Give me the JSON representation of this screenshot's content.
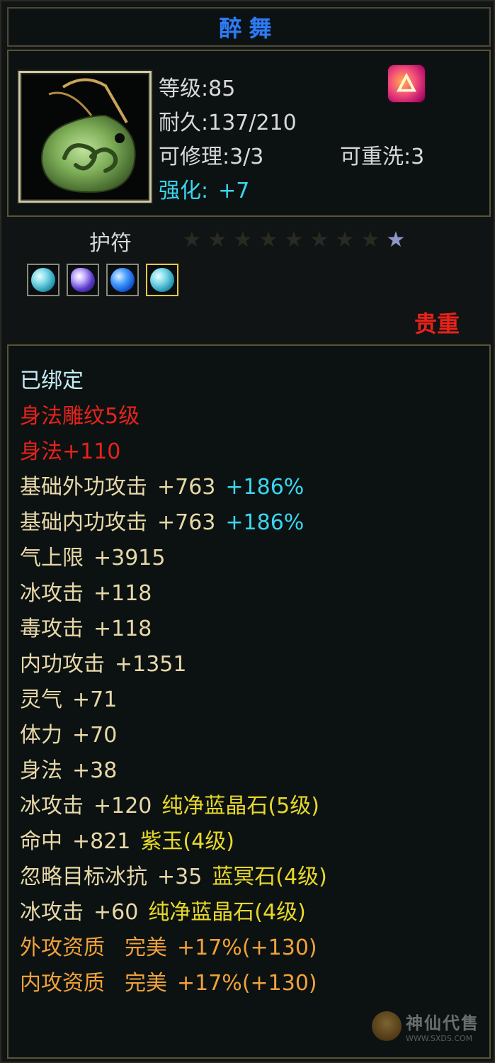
{
  "item": {
    "name": "醉舞",
    "level": "等级:85",
    "durability": "耐久:137/210",
    "repair": "可修理:3/3",
    "rewash": "可重洗:3",
    "enhance_label": "强化:",
    "enhance_value": "+7"
  },
  "type": "护符",
  "stars": {
    "total": 9,
    "lit": 1
  },
  "gems": [
    {
      "kind": "aqua",
      "slot": "normal"
    },
    {
      "kind": "purple",
      "slot": "normal"
    },
    {
      "kind": "blue",
      "slot": "normal"
    },
    {
      "kind": "aqua",
      "slot": "gold"
    }
  ],
  "rarity": "贵重",
  "attrs": {
    "bound": "已绑定",
    "carve": "身法雕纹5级",
    "carve_bonus": "身法+110",
    "ext_atk": {
      "label": "基础外功攻击",
      "value": "+763",
      "pct": "+186%"
    },
    "int_atk": {
      "label": "基础内功攻击",
      "value": "+763",
      "pct": "+186%"
    },
    "lines": [
      {
        "label": "气上限",
        "value": "+3915"
      },
      {
        "label": "冰攻击",
        "value": "+118"
      },
      {
        "label": "毒攻击",
        "value": "+118"
      },
      {
        "label": "内功攻击",
        "value": "+1351"
      },
      {
        "label": "灵气",
        "value": "+71"
      },
      {
        "label": "体力",
        "value": "+70"
      },
      {
        "label": "身法",
        "value": "+38"
      }
    ],
    "gem_lines": [
      {
        "label": "冰攻击",
        "value": "+120",
        "gem": "纯净蓝晶石(5级)"
      },
      {
        "label": "命中",
        "value": "+821",
        "gem": "紫玉(4级)"
      },
      {
        "label": "忽略目标冰抗",
        "value": "+35",
        "gem": "蓝冥石(4级)"
      },
      {
        "label": "冰攻击",
        "value": "+60",
        "gem": "纯净蓝晶石(4级)"
      }
    ],
    "quality": [
      {
        "label": "外攻资质",
        "grade": "完美",
        "value": "+17%(+130)"
      },
      {
        "label": "内攻资质",
        "grade": "完美",
        "value": "+17%(+130)"
      }
    ]
  },
  "watermark": {
    "main": "神仙代售",
    "url": "WWW.SXDS.COM"
  },
  "colors": {
    "title": "#2f7bf0",
    "cyan": "#3ad6f0",
    "red": "#e8221a",
    "gold_text": "#e8d8a8",
    "yellow": "#e8d82a",
    "orange": "#f0a13a"
  }
}
